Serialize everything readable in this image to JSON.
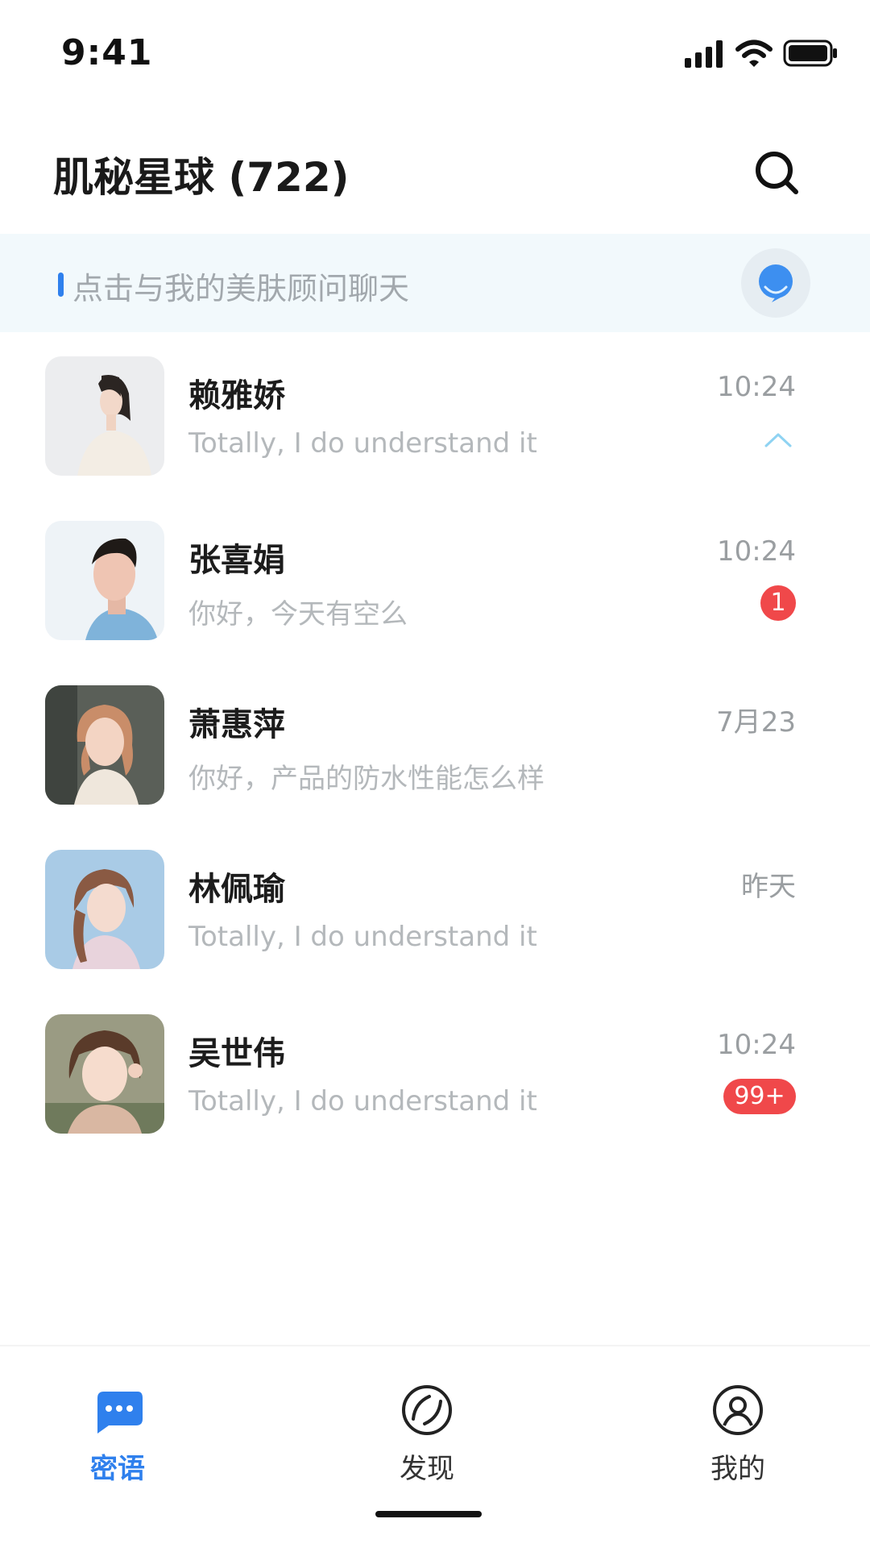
{
  "status_bar": {
    "time": "9:41"
  },
  "header": {
    "title": "肌秘星球 (722)"
  },
  "banner": {
    "text": "点击与我的美肤顾问聊天"
  },
  "chats": [
    {
      "name": "赖雅娇",
      "preview": "Totally, I do understand it",
      "time": "10:24",
      "badge": "",
      "pinned": true
    },
    {
      "name": "张喜娟",
      "preview": "你好，今天有空么",
      "time": "10:24",
      "badge": "1"
    },
    {
      "name": "萧惠萍",
      "preview": "你好，产品的防水性能怎么样",
      "time": "7月23",
      "badge": ""
    },
    {
      "name": "林佩瑜",
      "preview": "Totally, I do understand it",
      "time": "昨天",
      "badge": ""
    },
    {
      "name": "吴世伟",
      "preview": "Totally, I do understand it",
      "time": "10:24",
      "badge": "99+"
    }
  ],
  "tabs": [
    {
      "label": "密语",
      "icon": "chat-bubble-icon",
      "active": true
    },
    {
      "label": "发现",
      "icon": "discover-icon",
      "active": false
    },
    {
      "label": "我的",
      "icon": "profile-icon",
      "active": false
    }
  ],
  "colors": {
    "accent": "#2f80ed",
    "badge": "#f0484a",
    "banner_bg": "#f2f9fc"
  }
}
